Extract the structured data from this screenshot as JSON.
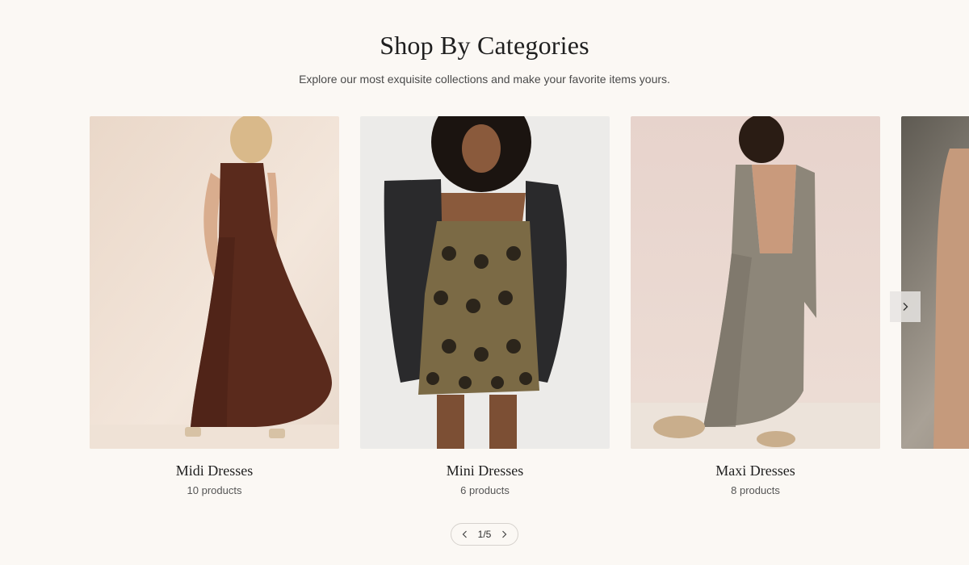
{
  "section": {
    "title": "Shop By Categories",
    "subtitle": "Explore our most exquisite collections and make your favorite items yours."
  },
  "categories": [
    {
      "title": "Midi Dresses",
      "count": "10 products"
    },
    {
      "title": "Mini Dresses",
      "count": "6 products"
    },
    {
      "title": "Maxi Dresses",
      "count": "8 products"
    }
  ],
  "pagination": {
    "label": "1/5"
  },
  "icons": {
    "prev": "chevron-left-icon",
    "next": "chevron-right-icon"
  }
}
